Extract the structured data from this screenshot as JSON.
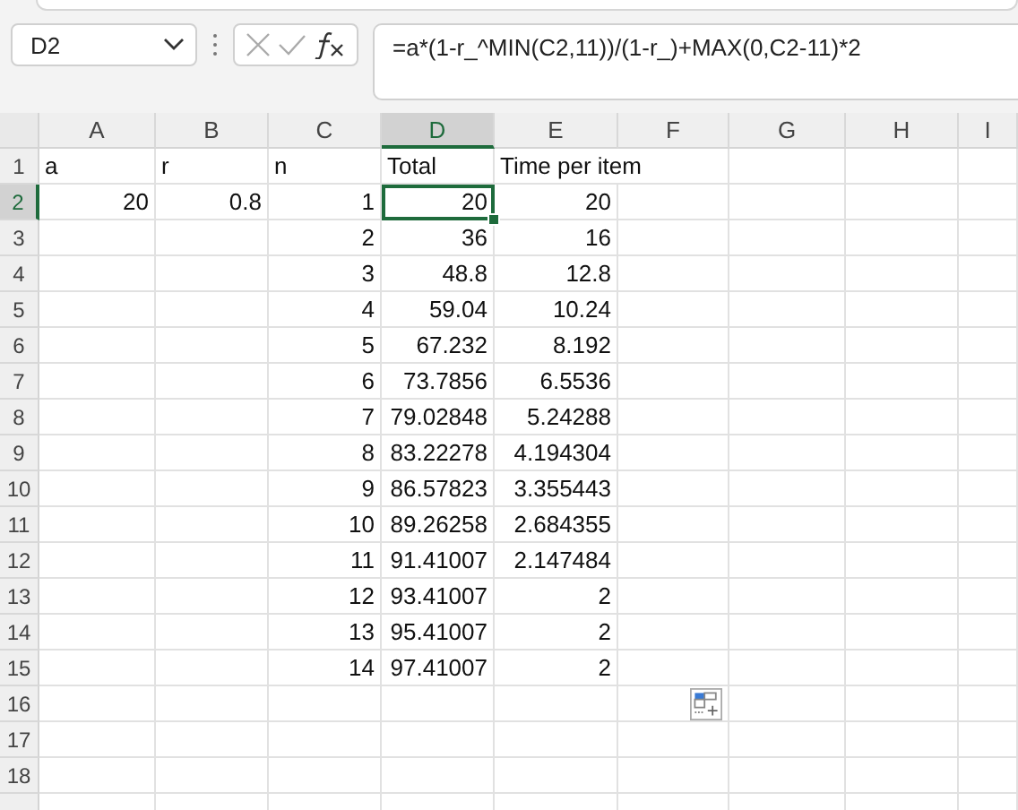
{
  "name_box": {
    "value": "D2"
  },
  "formula_bar": {
    "value": "=a*(1-r_^MIN(C2,11))/(1-r_)+MAX(0,C2-11)*2"
  },
  "columns": [
    {
      "label": "A",
      "selected": false
    },
    {
      "label": "B",
      "selected": false
    },
    {
      "label": "C",
      "selected": false
    },
    {
      "label": "D",
      "selected": true
    },
    {
      "label": "E",
      "selected": false
    },
    {
      "label": "F",
      "selected": false
    },
    {
      "label": "G",
      "selected": false
    },
    {
      "label": "H",
      "selected": false
    },
    {
      "label": "I",
      "selected": false
    }
  ],
  "rows": [
    {
      "label": "1",
      "selected": false,
      "kind": "text",
      "cells": [
        "a",
        "r",
        "n",
        "Total",
        "Time per item",
        null,
        null,
        null,
        null
      ]
    },
    {
      "label": "2",
      "selected": true,
      "kind": "number",
      "cells": [
        "20",
        "0.8",
        "1",
        "20",
        "20",
        null,
        null,
        null,
        null
      ]
    },
    {
      "label": "3",
      "selected": false,
      "kind": "number",
      "cells": [
        null,
        null,
        "2",
        "36",
        "16",
        null,
        null,
        null,
        null
      ]
    },
    {
      "label": "4",
      "selected": false,
      "kind": "number",
      "cells": [
        null,
        null,
        "3",
        "48.8",
        "12.8",
        null,
        null,
        null,
        null
      ]
    },
    {
      "label": "5",
      "selected": false,
      "kind": "number",
      "cells": [
        null,
        null,
        "4",
        "59.04",
        "10.24",
        null,
        null,
        null,
        null
      ]
    },
    {
      "label": "6",
      "selected": false,
      "kind": "number",
      "cells": [
        null,
        null,
        "5",
        "67.232",
        "8.192",
        null,
        null,
        null,
        null
      ]
    },
    {
      "label": "7",
      "selected": false,
      "kind": "number",
      "cells": [
        null,
        null,
        "6",
        "73.7856",
        "6.5536",
        null,
        null,
        null,
        null
      ]
    },
    {
      "label": "8",
      "selected": false,
      "kind": "number",
      "cells": [
        null,
        null,
        "7",
        "79.02848",
        "5.24288",
        null,
        null,
        null,
        null
      ]
    },
    {
      "label": "9",
      "selected": false,
      "kind": "number",
      "cells": [
        null,
        null,
        "8",
        "83.22278",
        "4.194304",
        null,
        null,
        null,
        null
      ]
    },
    {
      "label": "10",
      "selected": false,
      "kind": "number",
      "cells": [
        null,
        null,
        "9",
        "86.57823",
        "3.355443",
        null,
        null,
        null,
        null
      ]
    },
    {
      "label": "11",
      "selected": false,
      "kind": "number",
      "cells": [
        null,
        null,
        "10",
        "89.26258",
        "2.684355",
        null,
        null,
        null,
        null
      ]
    },
    {
      "label": "12",
      "selected": false,
      "kind": "number",
      "cells": [
        null,
        null,
        "11",
        "91.41007",
        "2.147484",
        null,
        null,
        null,
        null
      ]
    },
    {
      "label": "13",
      "selected": false,
      "kind": "number",
      "cells": [
        null,
        null,
        "12",
        "93.41007",
        "2",
        null,
        null,
        null,
        null
      ]
    },
    {
      "label": "14",
      "selected": false,
      "kind": "number",
      "cells": [
        null,
        null,
        "13",
        "95.41007",
        "2",
        null,
        null,
        null,
        null
      ]
    },
    {
      "label": "15",
      "selected": false,
      "kind": "number",
      "cells": [
        null,
        null,
        "14",
        "97.41007",
        "2",
        null,
        null,
        null,
        null
      ]
    },
    {
      "label": "16",
      "selected": false,
      "kind": "number",
      "cells": [
        null,
        null,
        null,
        null,
        null,
        null,
        null,
        null,
        null
      ]
    },
    {
      "label": "17",
      "selected": false,
      "kind": "number",
      "cells": [
        null,
        null,
        null,
        null,
        null,
        null,
        null,
        null,
        null
      ]
    },
    {
      "label": "18",
      "selected": false,
      "kind": "number",
      "cells": [
        null,
        null,
        null,
        null,
        null,
        null,
        null,
        null,
        null
      ]
    }
  ]
}
